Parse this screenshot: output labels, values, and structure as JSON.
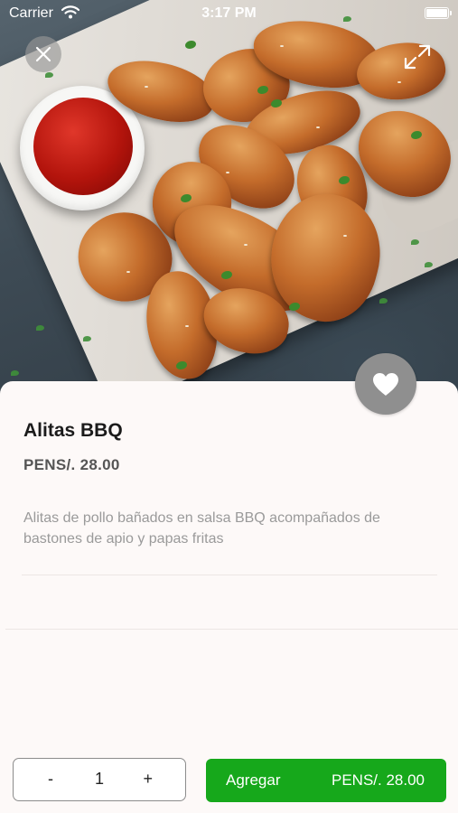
{
  "status_bar": {
    "carrier": "Carrier",
    "time": "3:17 PM",
    "wifi_icon": "wifi-icon",
    "battery_icon": "battery-icon"
  },
  "hero": {
    "image": "chicken-wings-photo",
    "close_icon": "close-icon",
    "expand_icon": "expand-icon"
  },
  "product": {
    "name": "Alitas BBQ",
    "price": "PENS/. 28.00",
    "description": "Alitas de pollo bañados en salsa BBQ acompañados de bastones de apio y papas fritas",
    "favorite_icon": "heart-icon"
  },
  "footer": {
    "minus_label": "-",
    "quantity": "1",
    "plus_label": "+",
    "add_label": "Agregar",
    "add_total": "PENS/. 28.00"
  },
  "colors": {
    "accent_green": "#16a81b",
    "favorite_gray": "#8f8f8f"
  }
}
